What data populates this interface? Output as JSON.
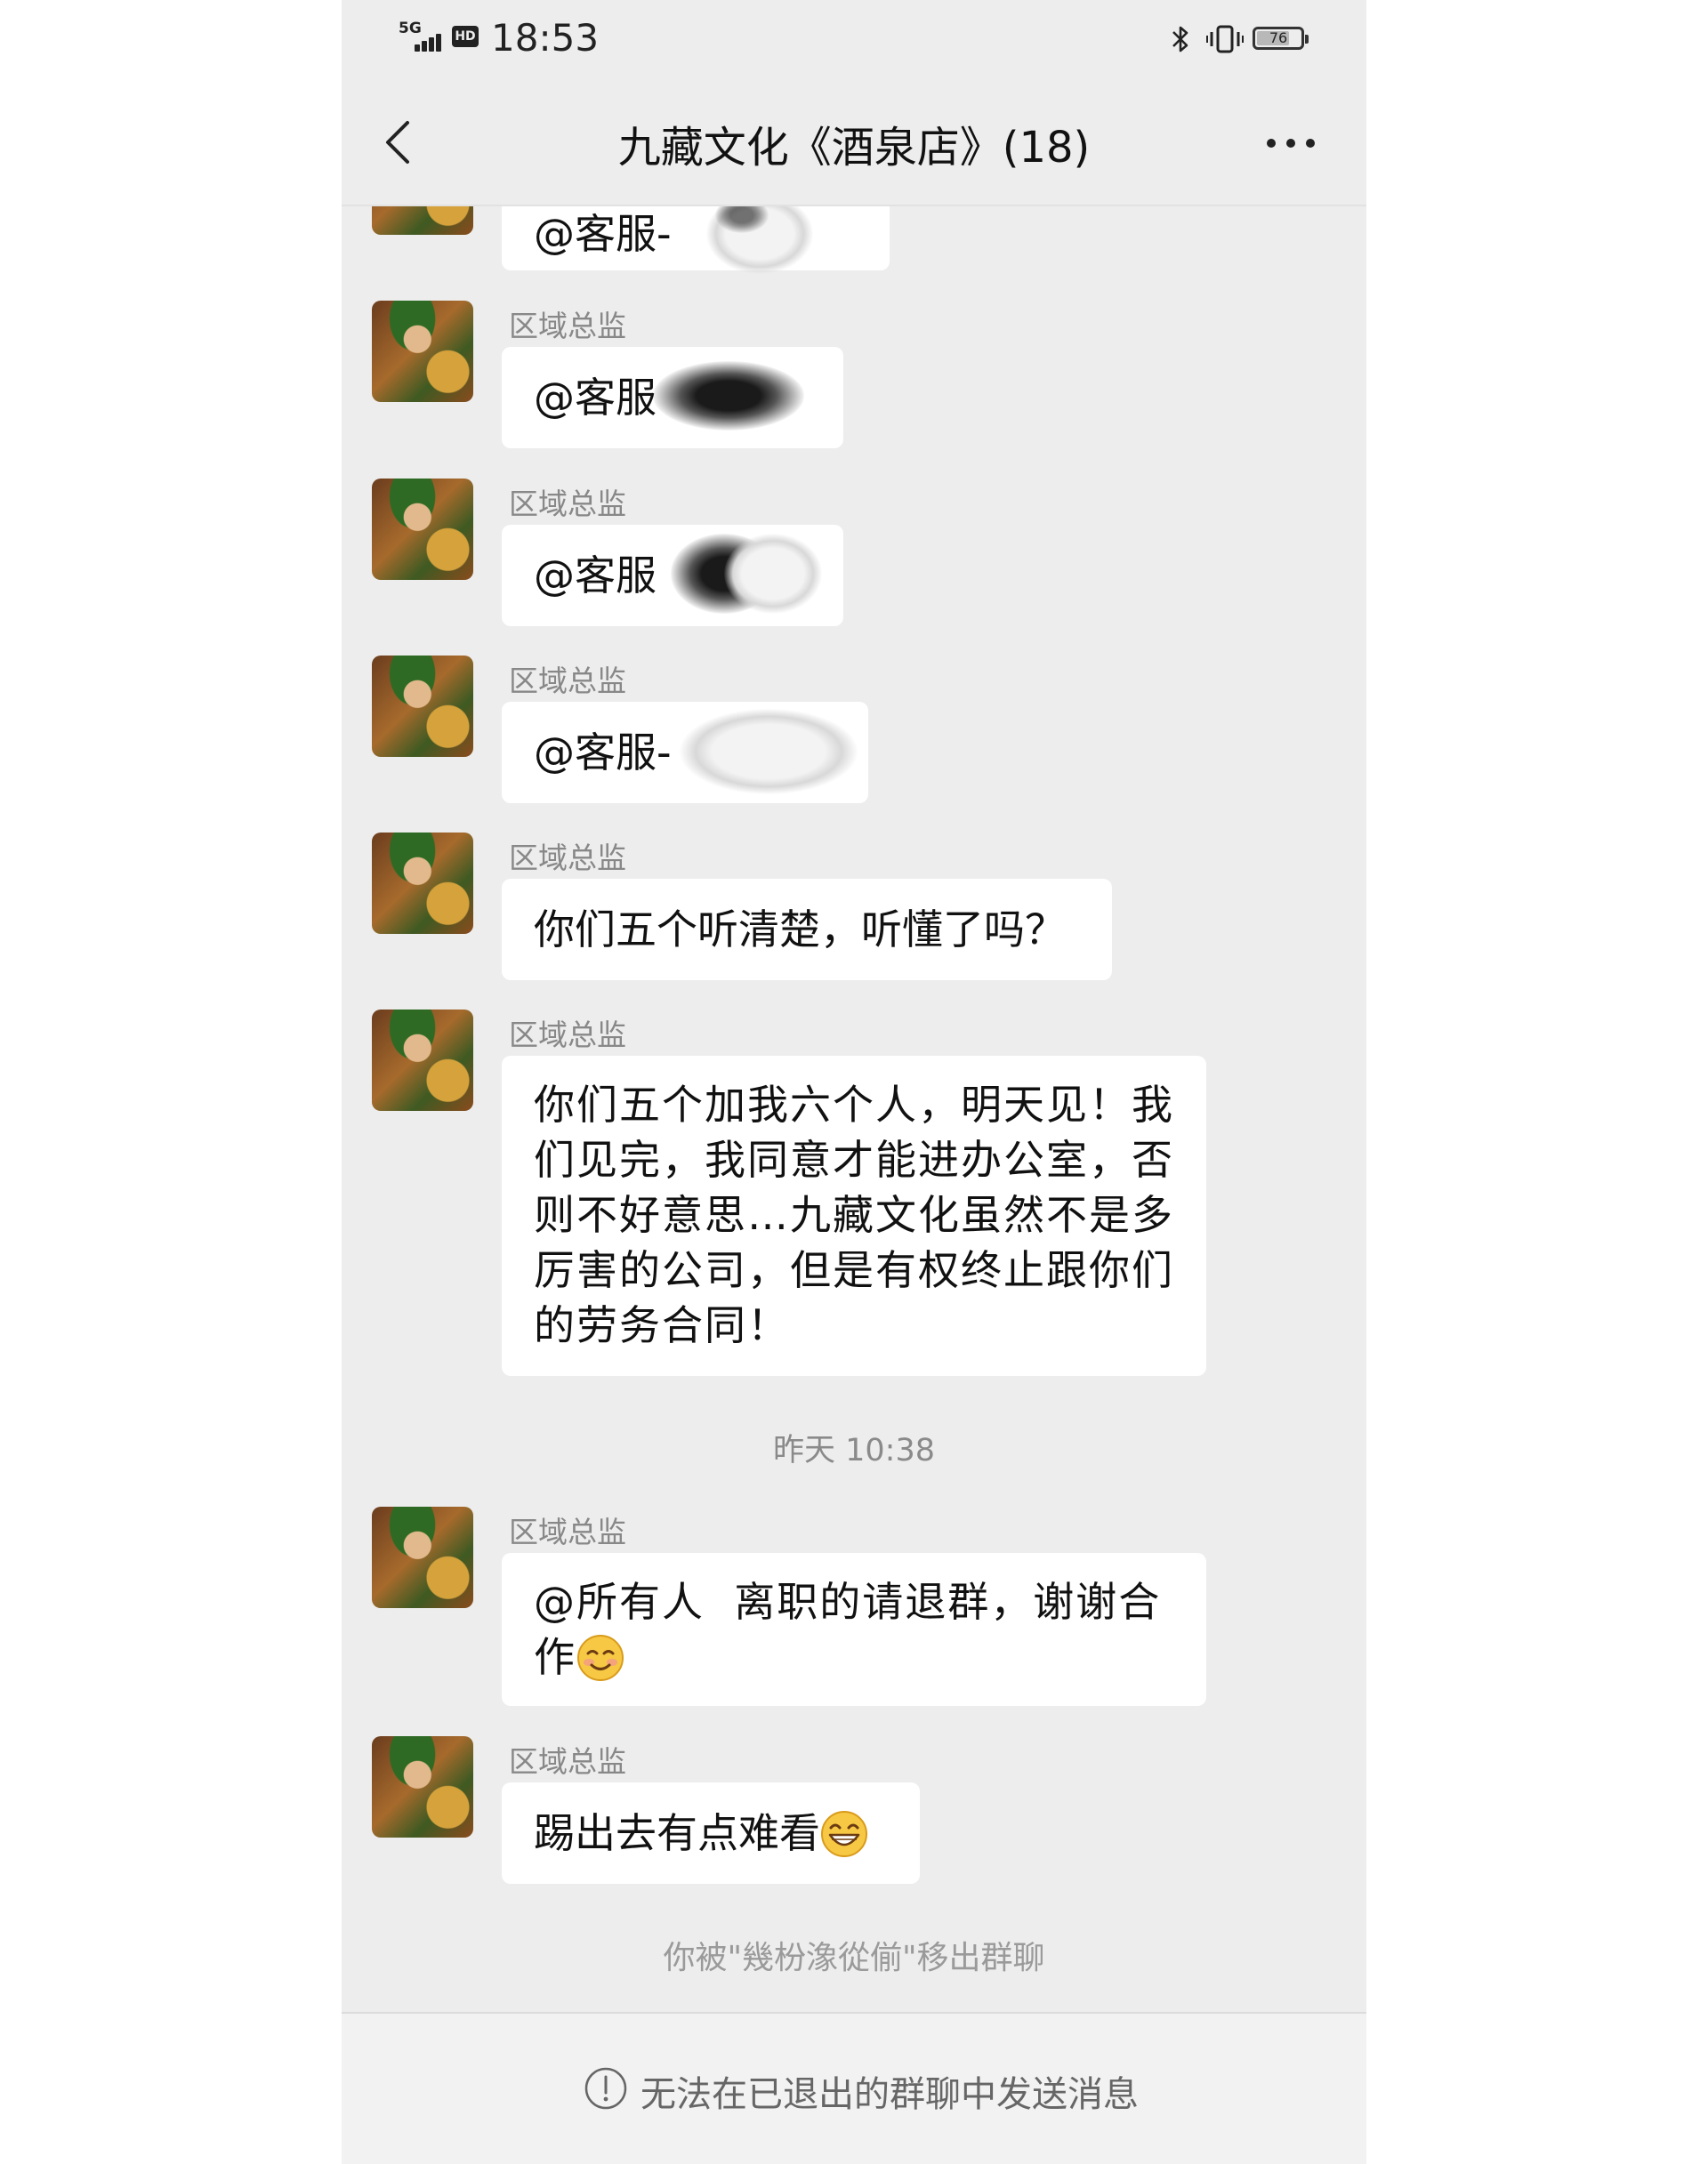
{
  "status_bar": {
    "network": "5G",
    "hd": "HD",
    "time": "18:53",
    "battery": "76",
    "battery_level": 0.76,
    "icons": [
      "signal-icon",
      "bluetooth-icon",
      "vibrate-icon",
      "battery-icon"
    ]
  },
  "header": {
    "title": "九藏文化《酒泉店》(18)",
    "back_icon": "chevron-left-icon",
    "more_icon": "more-icon"
  },
  "messages": [
    {
      "sender": "",
      "text": "@客服-"
    },
    {
      "sender": "区域总监",
      "text": "@客服"
    },
    {
      "sender": "区域总监",
      "text": "@客服"
    },
    {
      "sender": "区域总监",
      "text": "@客服-"
    },
    {
      "sender": "区域总监",
      "text": "你们五个听清楚，听懂了吗？"
    },
    {
      "sender": "区域总监",
      "text": "你们五个加我六个人，明天见！我们见完，我同意才能进办公室，否则不好意思…九藏文化虽然不是多厉害的公司，但是有权终止跟你们的劳务合同！"
    },
    {
      "sender": "区域总监",
      "text": "@所有人  离职的请退群，谢谢合作",
      "emoji": "smiling-face-emoji"
    },
    {
      "sender": "区域总监",
      "text": "踢出去有点难看",
      "emoji": "grinning-face-emoji"
    }
  ],
  "timestamp": "昨天 10:38",
  "system_note": "你被\"幾枌潒從偂\"移出群聊",
  "bottom_bar": {
    "text": "无法在已退出的群聊中发送消息",
    "icon": "warning-circle-icon"
  },
  "colors": {
    "chat_background": "#ededed",
    "bubble": "#ffffff",
    "secondary_text": "#888888"
  }
}
